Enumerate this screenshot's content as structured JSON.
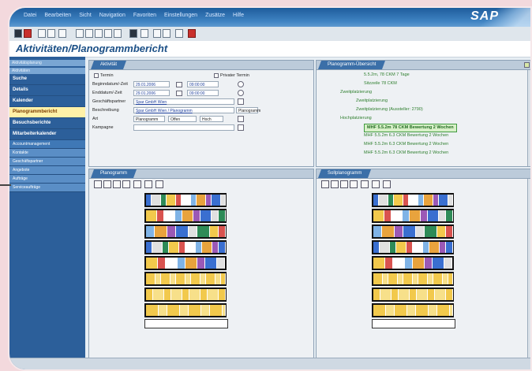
{
  "menu": {
    "items": [
      "Datei",
      "Bearbeiten",
      "Sicht",
      "Navigation",
      "Favoriten",
      "Einstellungen",
      "Zusätze",
      "Hilfe"
    ],
    "brand": "SAP"
  },
  "page": {
    "title": "Aktivitäten/Planogrammbericht"
  },
  "nav": {
    "header1": "Aktivitätsplanung",
    "header2": "Aktivitäten",
    "items": [
      {
        "label": "Suche",
        "selected": false
      },
      {
        "label": "Details",
        "selected": false
      },
      {
        "label": "Kalender",
        "selected": false
      },
      {
        "label": "Planogrammbericht",
        "selected": true
      },
      {
        "label": "Besuchsberichte",
        "selected": false
      },
      {
        "label": "Mitarbeiterkalender",
        "selected": false
      }
    ],
    "sub": [
      "Accountmanagement",
      "Kontakte",
      "Geschäftspartner",
      "Angebote",
      "Aufträge",
      "Serviceaufträge"
    ]
  },
  "activity": {
    "tab": "Aktivität",
    "termin_label": "Termin",
    "private_label": "Privater Termin",
    "begin_label": "Beginndatum/-Zeit",
    "begin_date": "29.01.2006",
    "begin_time": "09:00:00",
    "end_label": "Enddatum/-Zeit",
    "end_date": "29.01.2006",
    "end_time": "09:00:00",
    "partner_label": "Geschäftspartner",
    "partner_value": "Spar GmbH Wien",
    "desc_label": "Beschreibung",
    "desc_value": "Spar GmbH Wien / Planogramm",
    "art_label": "Art",
    "art_value": "Planogramm",
    "status_value": "Offen",
    "prio_value": "Hoch",
    "campaign_label": "Kampagne",
    "popup": "Planogramm"
  },
  "overview": {
    "tab": "Planogramm-Übersicht",
    "lines": [
      {
        "text": "5.5.2m, 78 CKM 7 Tage",
        "indent": 60,
        "selected": false
      },
      {
        "text": "Sitzzeile 78 CKM",
        "indent": 60,
        "selected": false
      },
      {
        "text": "Zweitplatzierung",
        "indent": 30,
        "selected": false
      },
      {
        "text": "Zweitplatzierung",
        "indent": 50,
        "selected": false
      },
      {
        "text": "Zweitplatzierung (Aussteller: 2790)",
        "indent": 50,
        "selected": false
      },
      {
        "text": "Hochplatzierung",
        "indent": 30,
        "selected": false
      },
      {
        "text": "MHF 5.5.2m 78 CKM Bewertung 2 Wochen",
        "indent": 60,
        "selected": true
      },
      {
        "text": "MHF 5.5.2m 6.3 CKM Bewertung 2 Wochen",
        "indent": 60,
        "selected": false
      },
      {
        "text": "MHF 5.5.2m 6.3 CKM Bewertung 2 Wochen",
        "indent": 60,
        "selected": false
      },
      {
        "text": "MHF 5.5.2m 6.3 CKM Bewertung 2 Wochen",
        "indent": 60,
        "selected": false
      }
    ]
  },
  "left_plan": {
    "tab": "Planogramm"
  },
  "right_plan": {
    "tab": "Sollplanogramm"
  },
  "colors": {
    "accent": "#2c5f9a",
    "selected_nav": "#fff1a8",
    "tree_green": "#2f7f2f"
  }
}
